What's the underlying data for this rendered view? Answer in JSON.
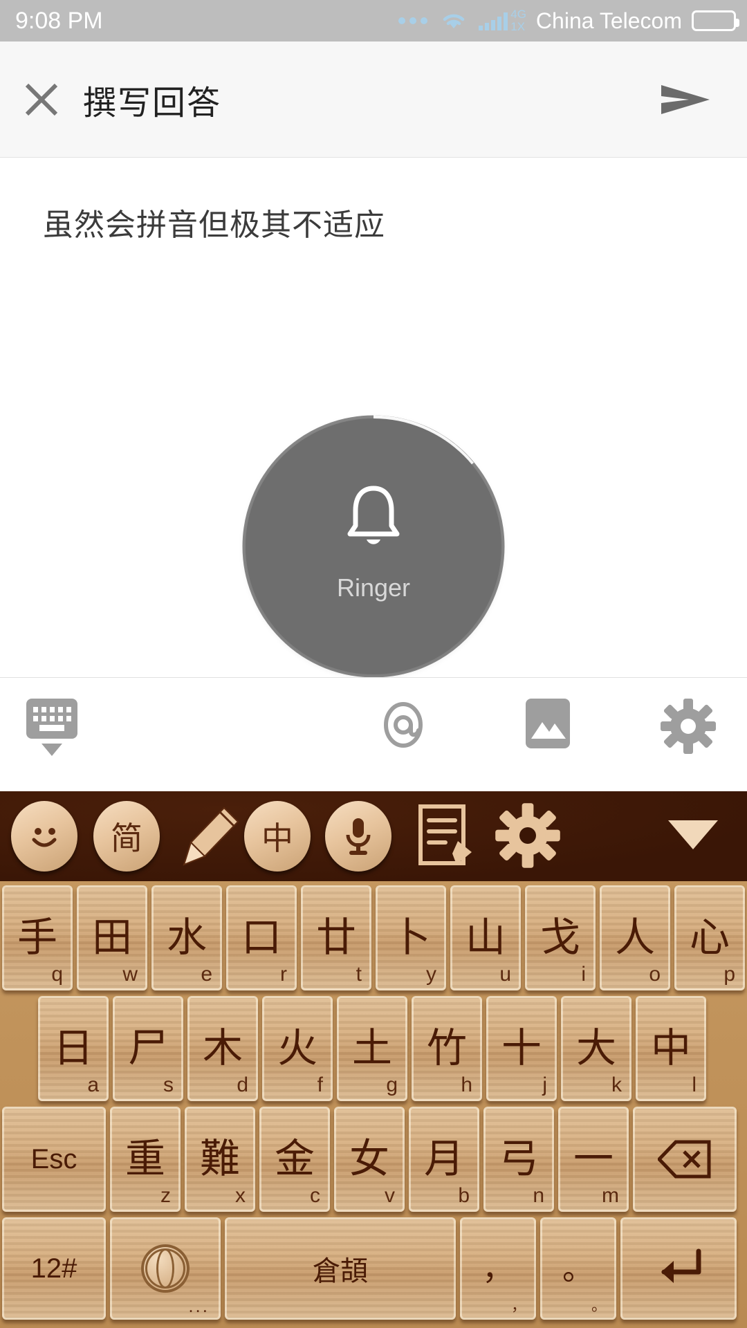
{
  "status_bar": {
    "time": "9:08 PM",
    "carrier": "China Telecom",
    "network_primary": "4G",
    "network_secondary": "1X",
    "icons": [
      "more-dots-icon",
      "wifi-icon",
      "signal-bars-icon",
      "battery-icon"
    ],
    "background_color": "#bdbdbd",
    "text_color": "#ffffff",
    "icon_color": "#a8cfe8"
  },
  "app_bar": {
    "close_label": "✕",
    "title": "撰写回答",
    "send_label": "send-icon",
    "background_color": "#f7f7f7"
  },
  "editor": {
    "text": "虽然会拼音但极其不适应",
    "placeholder": ""
  },
  "ringer_overlay": {
    "label": "Ringer",
    "icon": "bell-icon",
    "volume_percent": 15,
    "dial_color": "#6e6e6e",
    "track_color": "#8a8a8a",
    "progress_color": "#ffffff"
  },
  "attachment_bar": {
    "items": [
      {
        "name": "hide-keyboard-icon",
        "label": "keyboard-down-icon"
      },
      {
        "name": "mention-icon",
        "label": "@"
      },
      {
        "name": "image-icon",
        "label": "picture-icon"
      },
      {
        "name": "settings-icon",
        "label": "gear-icon"
      }
    ],
    "icon_color": "#9e9e9e"
  },
  "keyboard": {
    "toolbar": {
      "background_color": "#3a1606",
      "items": [
        {
          "name": "emoji-button",
          "label": "☺"
        },
        {
          "name": "simplified-toggle-button",
          "label": "简"
        },
        {
          "name": "handwriting-button",
          "label": "pen-icon"
        },
        {
          "name": "chinese-mode-button",
          "label": "中"
        },
        {
          "name": "voice-input-button",
          "label": "microphone-icon"
        },
        {
          "name": "notepad-button",
          "label": "note-edit-icon"
        },
        {
          "name": "keyboard-settings-button",
          "label": "gear-icon"
        },
        {
          "name": "collapse-toolbar-button",
          "label": "chevron-down-icon"
        }
      ]
    },
    "layout_name": "倉頡",
    "rows": [
      [
        {
          "glyph": "手",
          "sub": "q"
        },
        {
          "glyph": "田",
          "sub": "w"
        },
        {
          "glyph": "水",
          "sub": "e"
        },
        {
          "glyph": "口",
          "sub": "r"
        },
        {
          "glyph": "廿",
          "sub": "t"
        },
        {
          "glyph": "卜",
          "sub": "y"
        },
        {
          "glyph": "山",
          "sub": "u"
        },
        {
          "glyph": "戈",
          "sub": "i"
        },
        {
          "glyph": "人",
          "sub": "o"
        },
        {
          "glyph": "心",
          "sub": "p"
        }
      ],
      [
        {
          "glyph": "日",
          "sub": "a"
        },
        {
          "glyph": "尸",
          "sub": "s"
        },
        {
          "glyph": "木",
          "sub": "d"
        },
        {
          "glyph": "火",
          "sub": "f"
        },
        {
          "glyph": "土",
          "sub": "g"
        },
        {
          "glyph": "竹",
          "sub": "h"
        },
        {
          "glyph": "十",
          "sub": "j"
        },
        {
          "glyph": "大",
          "sub": "k"
        },
        {
          "glyph": "中",
          "sub": "l"
        }
      ],
      [
        {
          "glyph": "Esc",
          "sub": "",
          "type": "esc"
        },
        {
          "glyph": "重",
          "sub": "z"
        },
        {
          "glyph": "難",
          "sub": "x"
        },
        {
          "glyph": "金",
          "sub": "c"
        },
        {
          "glyph": "女",
          "sub": "v"
        },
        {
          "glyph": "月",
          "sub": "b"
        },
        {
          "glyph": "弓",
          "sub": "n"
        },
        {
          "glyph": "一",
          "sub": "m"
        },
        {
          "glyph": "backspace-icon",
          "sub": "",
          "type": "backspace"
        }
      ],
      [
        {
          "glyph": "12#",
          "sub": "",
          "type": "symbols"
        },
        {
          "glyph": "globe-icon",
          "sub": "...",
          "type": "globe"
        },
        {
          "glyph": "倉頡",
          "sub": "",
          "type": "space"
        },
        {
          "glyph": "，",
          "sub": "，",
          "type": "comma"
        },
        {
          "glyph": "。",
          "sub": "。",
          "type": "period"
        },
        {
          "glyph": "enter-icon",
          "sub": "",
          "type": "enter"
        }
      ]
    ]
  }
}
